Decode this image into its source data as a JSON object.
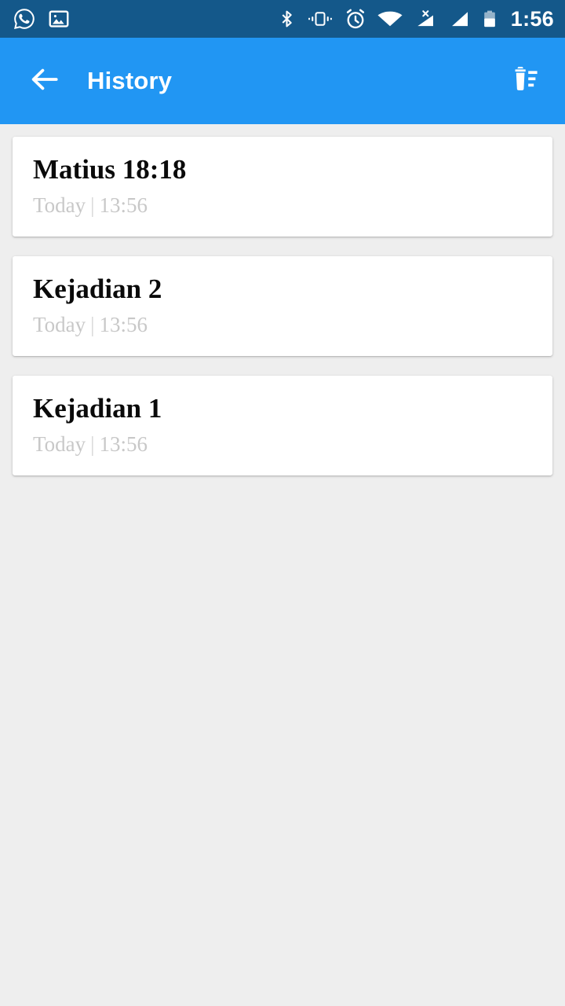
{
  "status_bar": {
    "background_color": "#14588a",
    "clock": "1:56",
    "left_icons": [
      {
        "name": "whatsapp-icon",
        "label": "WhatsApp notification"
      },
      {
        "name": "image-icon",
        "label": "Screenshot saved"
      }
    ],
    "right_icons": [
      {
        "name": "bluetooth-icon",
        "label": "Bluetooth on"
      },
      {
        "name": "vibrate-icon",
        "label": "Vibrate mode"
      },
      {
        "name": "alarm-icon",
        "label": "Alarm set"
      },
      {
        "name": "wifi-icon",
        "label": "Wi-Fi connected"
      },
      {
        "name": "no-sim-signal-icon",
        "label": "No SIM signal"
      },
      {
        "name": "signal-icon",
        "label": "Mobile signal"
      },
      {
        "name": "battery-icon",
        "label": "Battery 50 percent"
      }
    ]
  },
  "app_bar": {
    "background_color": "#2196f3",
    "title": "History",
    "back_icon": "arrow-back-icon",
    "delete_all_icon": "delete-sweep-icon"
  },
  "page": {
    "background_color": "#eeeeee"
  },
  "history": {
    "items": [
      {
        "title": "Matius 18:18",
        "day": "Today",
        "separator": "|",
        "time": "13:56"
      },
      {
        "title": "Kejadian 2",
        "day": "Today",
        "separator": "|",
        "time": "13:56"
      },
      {
        "title": "Kejadian 1",
        "day": "Today",
        "separator": "|",
        "time": "13:56"
      }
    ]
  }
}
